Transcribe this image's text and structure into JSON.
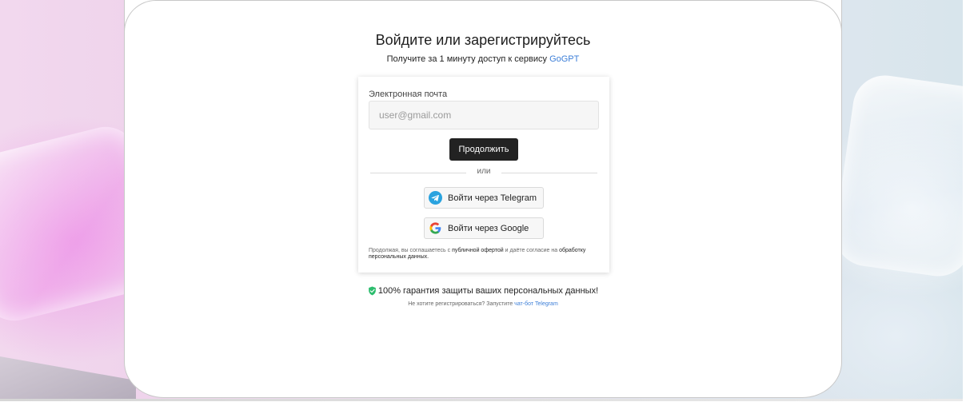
{
  "page": {
    "title": "Войдите или зарегистрируйтесь",
    "subtitle_prefix": "Получите за 1 минуту доступ к сервису",
    "brand_name": "GoGPT"
  },
  "form": {
    "email_label": "Электронная почта",
    "email_placeholder": "user@gmail.com",
    "email_value": "",
    "continue_label": "Продолжить",
    "divider_text": "или",
    "telegram_label": "Войти через Telegram",
    "google_label": "Войти через Google",
    "terms_prefix": "Продолжая, вы соглашаетесь с",
    "terms_offer_link": "публичной офертой",
    "terms_middle": "и даёте согласие на",
    "terms_data_link": "обработку персональных данных."
  },
  "footer": {
    "guarantee_text": "100% гарантия защиты ваших персональных данных!",
    "hint_prefix": "Не хотите регистрироваться? Запустите",
    "hint_link": "чат-бот Telegram"
  },
  "icons": {
    "telegram": "telegram-icon",
    "google": "google-icon",
    "guarantee": "shield-check-icon"
  },
  "colors": {
    "accent_link": "#3d7fd8",
    "primary_button": "#222222",
    "telegram_blue": "#2aa3df",
    "shield_green": "#2dbd6e"
  }
}
